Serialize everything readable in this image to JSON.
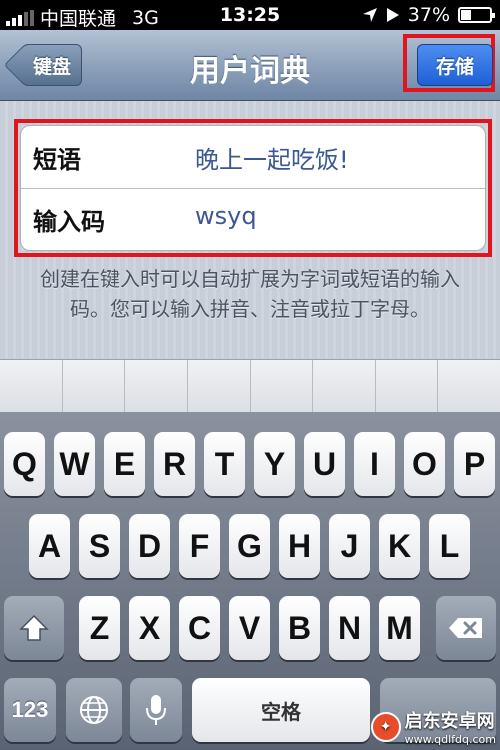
{
  "status_bar": {
    "carrier": "中国联通",
    "network": "3G",
    "time": "13:25",
    "battery": "37%",
    "battery_level": 0.37
  },
  "nav_bar": {
    "title": "用户词典",
    "back_label": "键盘",
    "save_label": "存储"
  },
  "form": {
    "phrase_label": "短语",
    "phrase_value": "晚上一起吃饭!",
    "shortcut_label": "输入码",
    "shortcut_value": "wsyq"
  },
  "hint": "创建在键入时可以自动扩展为字词或短语的输入码。您可以输入拼音、注音或拉丁字母。",
  "keyboard": {
    "row1": [
      "Q",
      "W",
      "E",
      "R",
      "T",
      "Y",
      "U",
      "I",
      "O",
      "P"
    ],
    "row2": [
      "A",
      "S",
      "D",
      "F",
      "G",
      "H",
      "J",
      "K",
      "L"
    ],
    "row3": [
      "Z",
      "X",
      "C",
      "V",
      "B",
      "N",
      "M"
    ],
    "numbers_label": "123",
    "space_label": "空格"
  },
  "watermark": {
    "name": "启东安卓网",
    "url": "www.qdlfdq.com"
  },
  "colors": {
    "highlight": "#e0151d",
    "save_button": "#2f6fe0",
    "nav_bar": "#8ea2bb"
  }
}
